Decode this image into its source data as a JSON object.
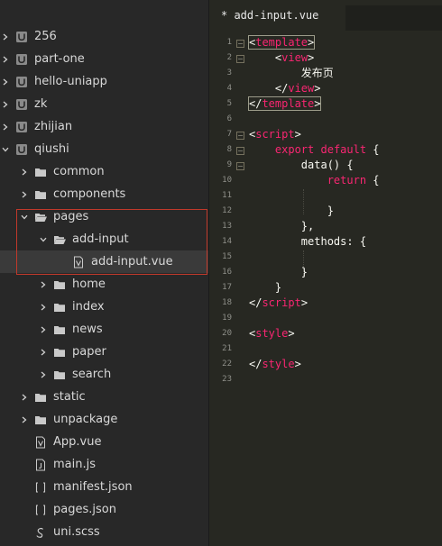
{
  "sidebar": {
    "items": [
      {
        "label": "256",
        "type": "project"
      },
      {
        "label": "part-one",
        "type": "project"
      },
      {
        "label": "hello-uniapp",
        "type": "project"
      },
      {
        "label": "zk",
        "type": "project"
      },
      {
        "label": "zhijian",
        "type": "project"
      },
      {
        "label": "qiushi",
        "type": "project"
      },
      {
        "label": "common",
        "type": "folder"
      },
      {
        "label": "components",
        "type": "folder"
      },
      {
        "label": "pages",
        "type": "folder"
      },
      {
        "label": "add-input",
        "type": "folder"
      },
      {
        "label": "add-input.vue",
        "type": "vue-file"
      },
      {
        "label": "home",
        "type": "folder"
      },
      {
        "label": "index",
        "type": "folder"
      },
      {
        "label": "news",
        "type": "folder"
      },
      {
        "label": "paper",
        "type": "folder"
      },
      {
        "label": "search",
        "type": "folder"
      },
      {
        "label": "static",
        "type": "folder"
      },
      {
        "label": "unpackage",
        "type": "folder"
      },
      {
        "label": "App.vue",
        "type": "vue-file"
      },
      {
        "label": "main.js",
        "type": "js-file"
      },
      {
        "label": "manifest.json",
        "type": "json-file"
      },
      {
        "label": "pages.json",
        "type": "json-file"
      },
      {
        "label": "uni.scss",
        "type": "scss-file"
      }
    ]
  },
  "editor": {
    "tab_title": "* add-input.vue",
    "line_numbers": [
      "1",
      "2",
      "3",
      "4",
      "5",
      "6",
      "7",
      "8",
      "9",
      "10",
      "11",
      "12",
      "13",
      "14",
      "15",
      "16",
      "17",
      "18",
      "19",
      "20",
      "21",
      "22",
      "23"
    ],
    "code": {
      "template_open": "template",
      "view_open": "view",
      "page_text": "发布页",
      "view_close": "view",
      "template_close": "template",
      "script_open": "script",
      "export_kw": "export",
      "default_kw": "default",
      "data_fn": "data() {",
      "return_kw": "return",
      "methods": "methods: {",
      "script_close": "script",
      "style_open": "style",
      "style_close": "style"
    }
  },
  "colors": {
    "sidebar_bg": "#282828",
    "editor_bg": "#272822",
    "tag": "#f92672",
    "highlight_border": "#c0392b"
  }
}
